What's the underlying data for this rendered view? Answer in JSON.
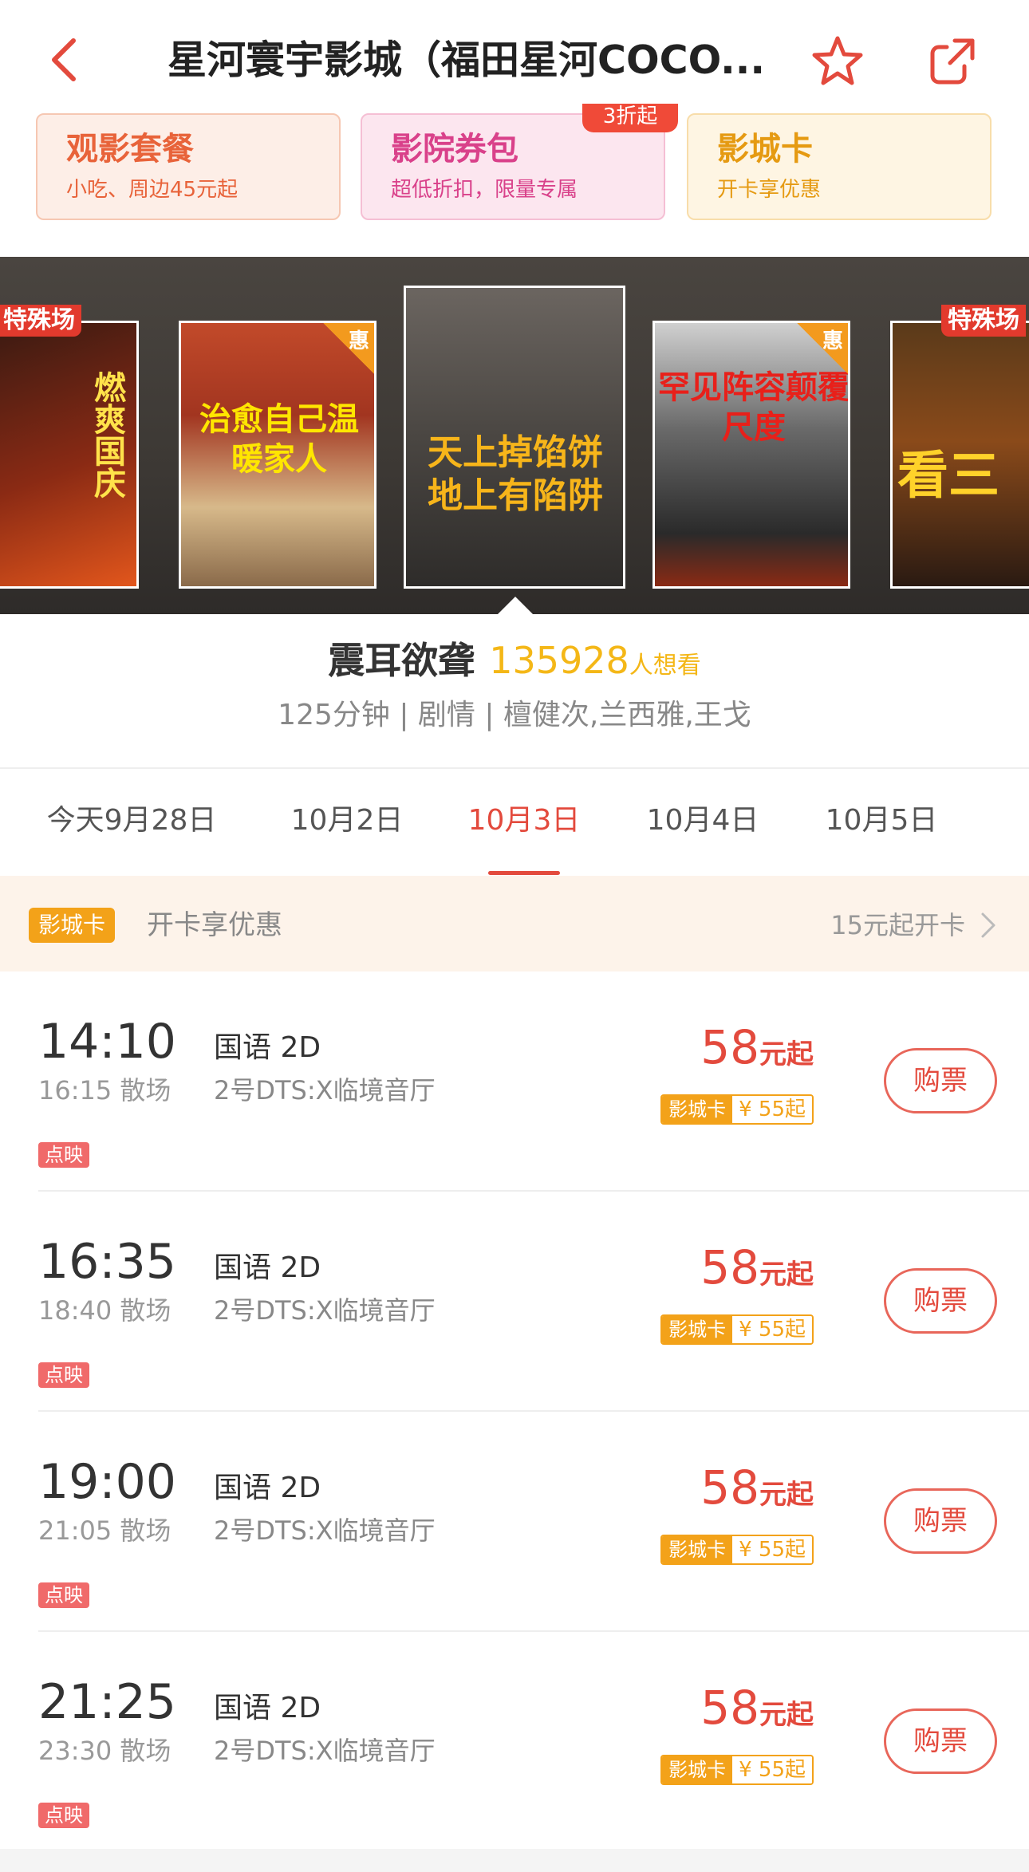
{
  "header": {
    "title": "星河寰宇影城（福田星河COCO...",
    "back_icon": "chevron-left-icon",
    "favorite_icon": "star-icon",
    "share_icon": "share-icon",
    "accent": "#e34a3d"
  },
  "promos": [
    {
      "title": "观影套餐",
      "subtitle": "小吃、周边45元起"
    },
    {
      "title": "影院券包",
      "subtitle": "超低折扣，限量专属",
      "badge": "3折起"
    },
    {
      "title": "影城卡",
      "subtitle": "开卡享优惠"
    }
  ],
  "posters": [
    {
      "tag": "特殊场",
      "text": "燃爽国庆"
    },
    {
      "tag": "惠",
      "text": "治愈自己温暖家人"
    },
    {
      "text": "天上掉馅饼地上有陷阱",
      "selected": true
    },
    {
      "tag": "惠",
      "text": "罕见阵容颠覆尺度"
    },
    {
      "tag": "特殊场",
      "text": "看三"
    }
  ],
  "movie": {
    "name": "震耳欲聋",
    "want_count": "135928",
    "want_label": "人想看",
    "details": "125分钟 | 剧情 | 檀健次,兰西雅,王戈"
  },
  "dates": [
    {
      "label": "今天9月28日"
    },
    {
      "label": "10月2日"
    },
    {
      "label": "10月3日",
      "active": true
    },
    {
      "label": "10月4日"
    },
    {
      "label": "10月5日"
    }
  ],
  "card_bar": {
    "badge": "影城卡",
    "text": "开卡享优惠",
    "right": "15元起开卡"
  },
  "showtimes": [
    {
      "start": "14:10",
      "end": "16:15 散场",
      "tag": "点映",
      "lang": "国语 2D",
      "hall": "2号DTS:X临境音厅",
      "price": "58",
      "unit": "元起",
      "member_label": "影城卡",
      "member_price": "¥ 55起",
      "buy": "购票"
    },
    {
      "start": "16:35",
      "end": "18:40 散场",
      "tag": "点映",
      "lang": "国语 2D",
      "hall": "2号DTS:X临境音厅",
      "price": "58",
      "unit": "元起",
      "member_label": "影城卡",
      "member_price": "¥ 55起",
      "buy": "购票"
    },
    {
      "start": "19:00",
      "end": "21:05 散场",
      "tag": "点映",
      "lang": "国语 2D",
      "hall": "2号DTS:X临境音厅",
      "price": "58",
      "unit": "元起",
      "member_label": "影城卡",
      "member_price": "¥ 55起",
      "buy": "购票"
    },
    {
      "start": "21:25",
      "end": "23:30 散场",
      "tag": "点映",
      "lang": "国语 2D",
      "hall": "2号DTS:X临境音厅",
      "price": "58",
      "unit": "元起",
      "member_label": "影城卡",
      "member_price": "¥ 55起",
      "buy": "购票"
    }
  ]
}
